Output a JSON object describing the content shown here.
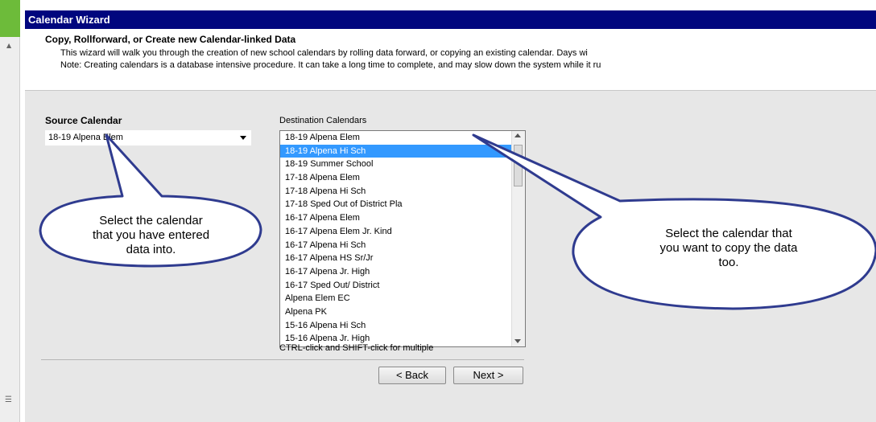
{
  "wizard": {
    "title": "Calendar Wizard",
    "heading": "Copy, Rollforward, or Create new Calendar-linked Data",
    "description": "This wizard will walk you through the creation of new school calendars by rolling data forward, or copying an existing calendar. Days wi",
    "note": "Note: Creating calendars is a database intensive procedure. It can take a long time to complete, and may slow down the system while it ru"
  },
  "source": {
    "label": "Source Calendar",
    "selected": "18-19 Alpena Elem"
  },
  "destination": {
    "label": "Destination Calendars",
    "items": [
      "18-19 Alpena Elem",
      "18-19 Alpena Hi Sch",
      "18-19 Summer School",
      "17-18 Alpena Elem",
      "17-18 Alpena Hi Sch",
      "17-18 Sped Out of District Pla",
      "16-17 Alpena Elem",
      "16-17 Alpena Elem Jr. Kind",
      "16-17 Alpena Hi Sch",
      "16-17 Alpena HS Sr/Jr",
      "16-17 Alpena Jr. High",
      "16-17 Sped Out/ District",
      "Alpena Elem EC",
      "Alpena PK",
      "15-16 Alpena Hi Sch",
      "15-16 Alpena Jr. High"
    ],
    "selected": "18-19 Alpena Hi Sch",
    "hint": "CTRL-click and SHIFT-click for multiple"
  },
  "buttons": {
    "back": "< Back",
    "next": "Next >"
  },
  "callouts": {
    "source_text": [
      "Select the calendar",
      "that you have entered",
      "data into."
    ],
    "destination_text": [
      "Select the calendar that",
      "you want to copy the data",
      "too."
    ]
  },
  "colors": {
    "title_bar": "#00067e",
    "selection": "#3399ff",
    "accent_green": "#6dbb3a",
    "callout_border": "#2f3b8f"
  },
  "icons": [
    "scroll-up-icon",
    "scroll-down-icon",
    "dropdown-arrow-icon"
  ]
}
